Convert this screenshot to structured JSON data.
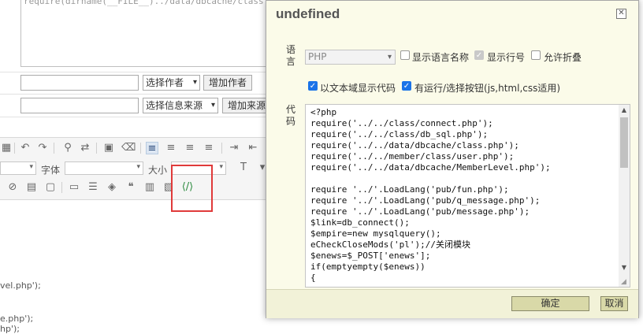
{
  "background": {
    "textarea_text": "require(dirname(__FILE__)../data/dbcache/class.php",
    "author_select": "选择作者",
    "add_author_button": "增加作者",
    "source_select": "选择信息来源",
    "add_source_button": "增加来源",
    "toolbar": {
      "font_label": "字体",
      "size_label": "大小"
    },
    "code_lines": [
      "vel.php');",
      "e.php');",
      "hp');"
    ]
  },
  "dialog": {
    "title": "undefined",
    "close_glyph": "✕",
    "language_label": "语言",
    "language_value": "PHP",
    "show_language_name": "显示语言名称",
    "show_line_numbers": "显示行号",
    "allow_folding": "允许折叠",
    "textarea_display": "以文本域显示代码",
    "run_button_option": "有运行/选择按钮(js,html,css适用)",
    "code_label": "代码",
    "code_lines": [
      "<?php",
      "require('../../class/connect.php');",
      "require('../../class/db_sql.php');",
      "require('../../data/dbcache/class.php');",
      "require('../../member/class/user.php');",
      "require('../../data/dbcache/MemberLevel.php');",
      "",
      "require '../'.LoadLang('pub/fun.php');",
      "require '../'.LoadLang('pub/q_message.php');",
      "require '../'.LoadLang('pub/message.php');",
      "$link=db_connect();",
      "$empire=new mysqlquery();",
      "eCheckCloseMods('pl');//关闭模块",
      "$enews=$_POST['enews'];",
      "if(emptyempty($enews))",
      "{"
    ],
    "ok_button": "确定",
    "cancel_button": "取消"
  },
  "colors": {
    "highlight": "#e03a3a",
    "checkbox_accent": "#1a73e8",
    "dialog_bg": "#fbfbe9"
  }
}
